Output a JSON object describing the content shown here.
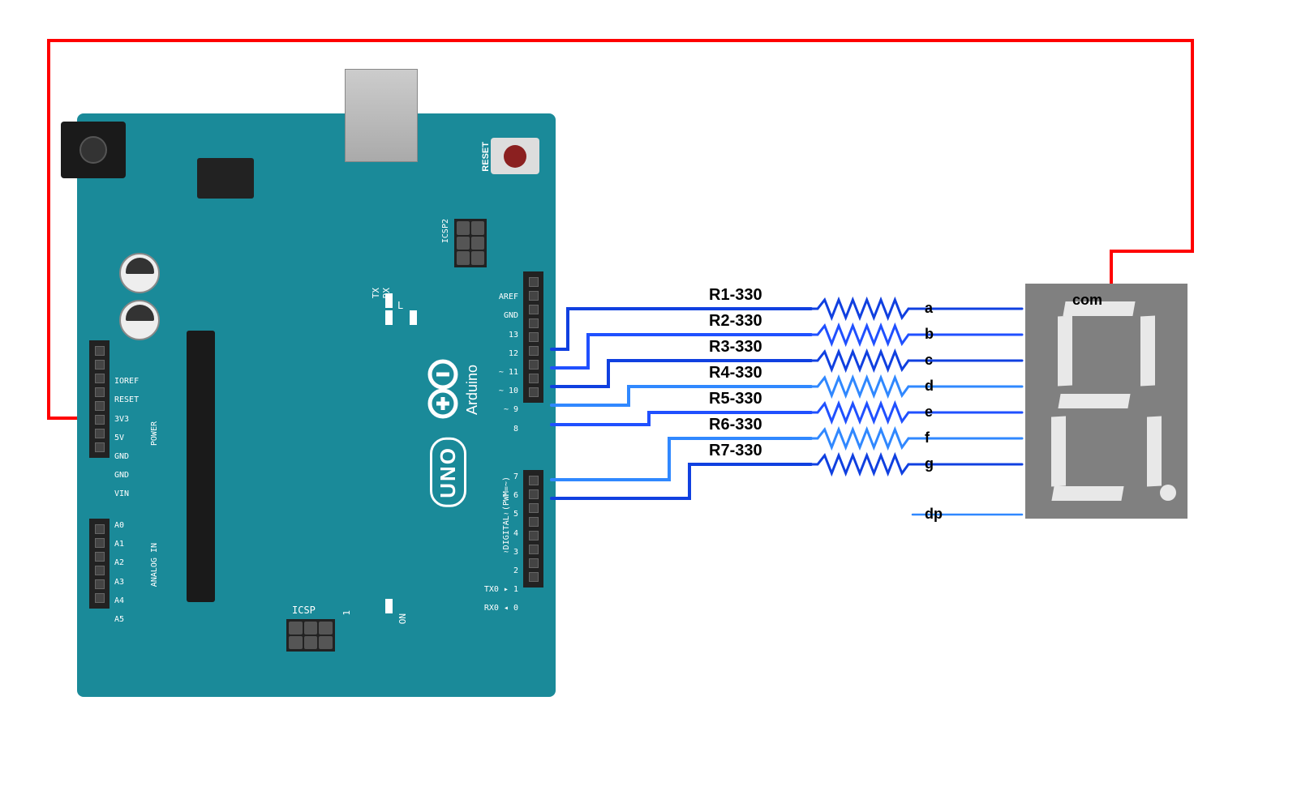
{
  "board": {
    "name": "Arduino",
    "model": "UNO",
    "reset_label": "RESET",
    "icsp_label": "ICSP",
    "icsp2_label": "ICSP2",
    "tx_label": "TX",
    "rx_label": "RX",
    "l_label": "L",
    "on_label": "ON",
    "one_label": "1",
    "digital_label": "DIGITAL (PWM=~)",
    "power_section_label": "POWER",
    "analog_section_label": "ANALOG IN"
  },
  "left_pins_power": [
    {
      "label": "IOREF"
    },
    {
      "label": "RESET"
    },
    {
      "label": "3V3"
    },
    {
      "label": "5V"
    },
    {
      "label": "GND"
    },
    {
      "label": "GND"
    },
    {
      "label": "VIN"
    }
  ],
  "left_pins_analog": [
    {
      "label": "A0"
    },
    {
      "label": "A1"
    },
    {
      "label": "A2"
    },
    {
      "label": "A3"
    },
    {
      "label": "A4"
    },
    {
      "label": "A5"
    }
  ],
  "right_pins_top": [
    {
      "label": ""
    },
    {
      "label": "AREF"
    },
    {
      "label": "GND"
    },
    {
      "label": "13"
    },
    {
      "label": "12"
    },
    {
      "label": "~ 11"
    },
    {
      "label": "~ 10"
    },
    {
      "label": "~ 9"
    },
    {
      "label": "8"
    }
  ],
  "right_pins_bottom": [
    {
      "label": "7"
    },
    {
      "label": "~ 6"
    },
    {
      "label": "~ 5"
    },
    {
      "label": "4"
    },
    {
      "label": "~ 3"
    },
    {
      "label": "2"
    },
    {
      "label": "TX0 ▸ 1"
    },
    {
      "label": "RX0 ◂ 0"
    }
  ],
  "resistors": [
    {
      "label": "R1-330"
    },
    {
      "label": "R2-330"
    },
    {
      "label": "R3-330"
    },
    {
      "label": "R4-330"
    },
    {
      "label": "R5-330"
    },
    {
      "label": "R6-330"
    },
    {
      "label": "R7-330"
    }
  ],
  "display": {
    "com_label": "com",
    "pins": [
      {
        "label": "a"
      },
      {
        "label": "b"
      },
      {
        "label": "c"
      },
      {
        "label": "d"
      },
      {
        "label": "e"
      },
      {
        "label": "f"
      },
      {
        "label": "g"
      },
      {
        "label": "dp"
      }
    ]
  },
  "connections": [
    {
      "from_pin": "12",
      "resistor": "R1-330",
      "to_seg": "a",
      "color": "#1040e0"
    },
    {
      "from_pin": "11",
      "resistor": "R2-330",
      "to_seg": "b",
      "color": "#2050ff"
    },
    {
      "from_pin": "10",
      "resistor": "R3-330",
      "to_seg": "c",
      "color": "#1040e0"
    },
    {
      "from_pin": "9",
      "resistor": "R4-330",
      "to_seg": "d",
      "color": "#3088ff"
    },
    {
      "from_pin": "8",
      "resistor": "R5-330",
      "to_seg": "e",
      "color": "#2050ff"
    },
    {
      "from_pin": "7",
      "resistor": "R6-330",
      "to_seg": "f",
      "color": "#3088ff"
    },
    {
      "from_pin": "6",
      "resistor": "R7-330",
      "to_seg": "g",
      "color": "#1040e0"
    }
  ],
  "power_wire": {
    "from": "5V",
    "to": "com",
    "color": "#ff0000"
  }
}
